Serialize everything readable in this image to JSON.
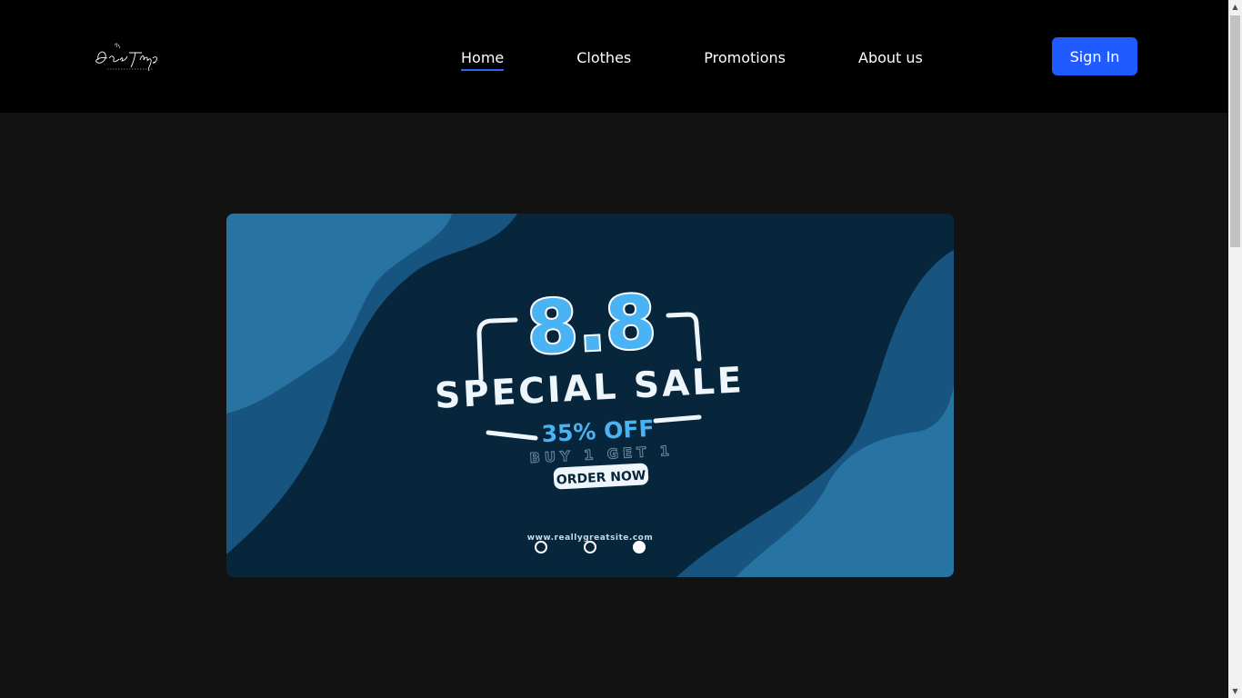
{
  "nav": {
    "logo_text": "Ice Shop",
    "links": [
      {
        "label": "Home",
        "active": true
      },
      {
        "label": "Clothes",
        "active": false
      },
      {
        "label": "Promotions",
        "active": false
      },
      {
        "label": "About us",
        "active": false
      }
    ],
    "signin_label": "Sign In"
  },
  "banner": {
    "headline": "8.8",
    "title": "SPECIAL SALE",
    "discount": "35% OFF",
    "offer": "BUY 1 GET 1",
    "cta": "ORDER NOW",
    "website": "www.reallygreatsite.com",
    "colors": {
      "background": "#08263b",
      "wave_light": "#2774a3",
      "wave_mid": "#175580",
      "accent": "#4ab3f4"
    }
  },
  "carousel": {
    "slide_count": 3,
    "active_index": 2
  },
  "colors": {
    "accent": "#1f5bff",
    "header_bg": "#000000",
    "page_bg": "#121212"
  }
}
